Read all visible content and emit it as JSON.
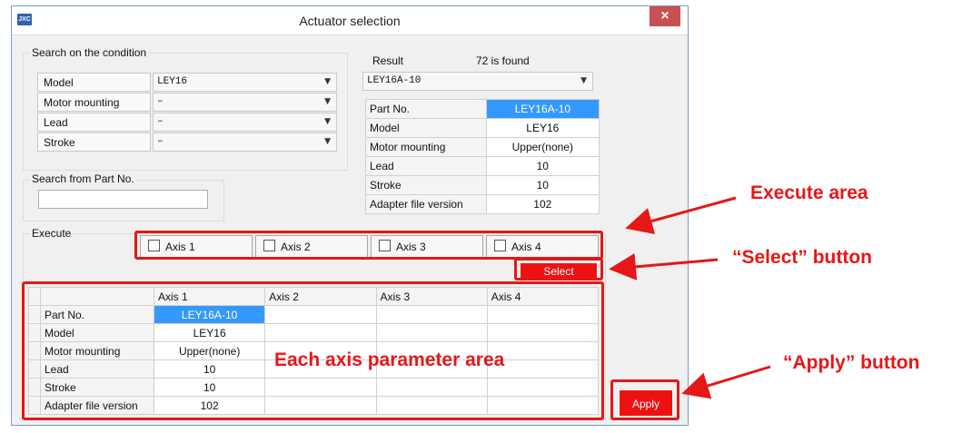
{
  "window": {
    "title": "Actuator selection",
    "app_icon": "JXC",
    "close_symbol": "×"
  },
  "search_condition": {
    "label": "Search on the condition",
    "rows": [
      {
        "label": "Model",
        "value": "LEY16"
      },
      {
        "label": "Motor mounting",
        "value": "–"
      },
      {
        "label": "Lead",
        "value": "–"
      },
      {
        "label": "Stroke",
        "value": "–"
      }
    ]
  },
  "search_part": {
    "label": "Search from Part No.",
    "value": ""
  },
  "result": {
    "label": "Result",
    "count_text": "72 is found",
    "selected": "LEY16A-10",
    "table": [
      {
        "label": "Part No.",
        "value": "LEY16A-10"
      },
      {
        "label": "Model",
        "value": "LEY16"
      },
      {
        "label": "Motor mounting",
        "value": "Upper(none)"
      },
      {
        "label": "Lead",
        "value": "10"
      },
      {
        "label": "Stroke",
        "value": "10"
      },
      {
        "label": "Adapter file version",
        "value": "102"
      }
    ]
  },
  "execute": {
    "label": "Execute",
    "axes": [
      "Axis 1",
      "Axis 2",
      "Axis 3",
      "Axis 4"
    ],
    "select_label": "Select",
    "apply_label": "Apply"
  },
  "params": {
    "headers": [
      "",
      "Axis 1",
      "Axis 2",
      "Axis 3",
      "Axis 4"
    ],
    "rows": [
      {
        "label": "Part No.",
        "axis1": "LEY16A-10"
      },
      {
        "label": "Model",
        "axis1": "LEY16"
      },
      {
        "label": "Motor mounting",
        "axis1": "Upper(none)"
      },
      {
        "label": "Lead",
        "axis1": "10"
      },
      {
        "label": "Stroke",
        "axis1": "10"
      },
      {
        "label": "Adapter file version",
        "axis1": "102"
      }
    ]
  },
  "annotations": {
    "execute_area": "Execute area",
    "select_button": "“Select” button",
    "param_area": "Each axis parameter area",
    "apply_button": "“Apply” button"
  },
  "colors": {
    "highlight": "#e51717",
    "selection": "#3399ff",
    "button_red": "#ee1111"
  }
}
